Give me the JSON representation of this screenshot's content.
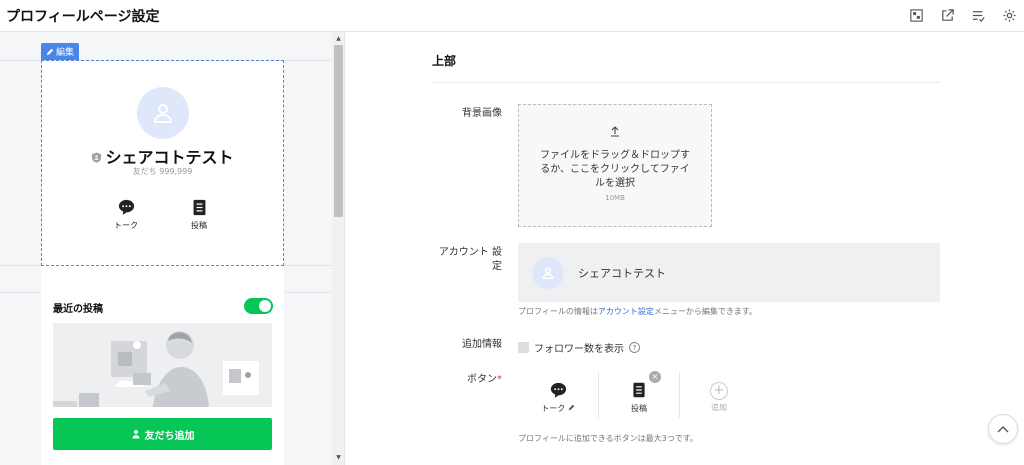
{
  "header": {
    "title": "プロフィールページ設定",
    "icons": [
      "qr-code-icon",
      "external-link-icon",
      "list-check-icon",
      "gear-icon"
    ]
  },
  "preview": {
    "edit_label": "編集",
    "account_name": "シェアコトテスト",
    "friends_count": "友だち 999,999",
    "buttons": [
      {
        "label": "トーク",
        "icon": "chat-icon"
      },
      {
        "label": "投稿",
        "icon": "post-icon"
      }
    ],
    "recent_posts_label": "最近の投稿",
    "recent_posts_enabled": true,
    "add_friend_label": "友だち追加"
  },
  "settings": {
    "section_title": "上部",
    "background_label": "背景画像",
    "upload_text": "ファイルをドラッグ＆ドロップするか、ここをクリックしてファイルを選択",
    "upload_size": "10MB",
    "account_label_line1": "アカウント 設",
    "account_label_line2": "定",
    "account_name": "シェアコトテスト",
    "account_hint_prefix": "プロフィールの情報は",
    "account_hint_link": "アカウント設定",
    "account_hint_suffix": "メニューから編集できます。",
    "additional_label": "追加情報",
    "follower_checkbox_label": "フォロワー数を表示",
    "follower_checked": false,
    "buttons_label": "ボタン",
    "required_mark": "*",
    "buttons": [
      {
        "label": "トーク",
        "icon": "chat-icon"
      },
      {
        "label": "投稿",
        "icon": "post-icon"
      }
    ],
    "add_label": "追加",
    "buttons_hint": "プロフィールに追加できるボタンは最大3つです。"
  },
  "colors": {
    "accent": "#4a86e8",
    "line_green": "#06c755",
    "link": "#2e6ed8"
  }
}
